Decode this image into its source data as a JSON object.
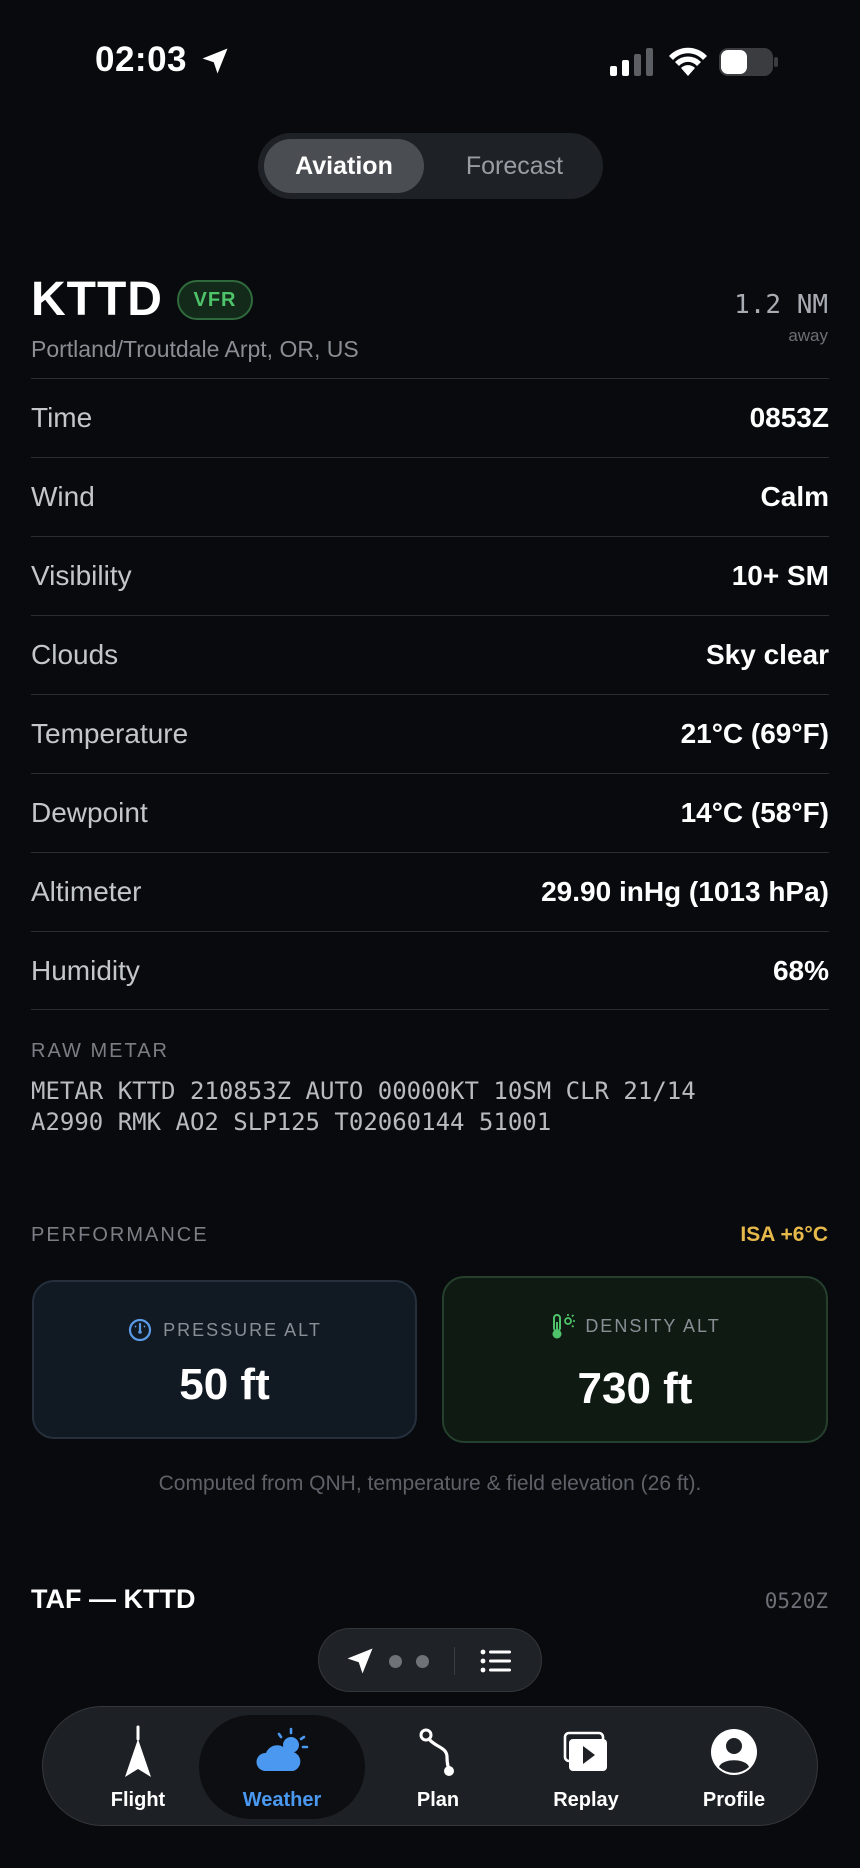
{
  "status_bar": {
    "time": "02:03"
  },
  "segment": {
    "options": [
      "Aviation",
      "Forecast"
    ],
    "selected": "Aviation"
  },
  "station": {
    "id": "KTTD",
    "category": "VFR",
    "name": "Portland/Troutdale Arpt, OR, US",
    "distance": "1.2 NM",
    "distance_suffix": "away"
  },
  "rows": [
    {
      "label": "Time",
      "value": "0853Z"
    },
    {
      "label": "Wind",
      "value": "Calm"
    },
    {
      "label": "Visibility",
      "value": "10+ SM"
    },
    {
      "label": "Clouds",
      "value": "Sky clear"
    },
    {
      "label": "Temperature",
      "value": "21°C (69°F)"
    },
    {
      "label": "Dewpoint",
      "value": "14°C (58°F)"
    },
    {
      "label": "Altimeter",
      "value": "29.90 inHg (1013 hPa)"
    },
    {
      "label": "Humidity",
      "value": "68%"
    }
  ],
  "raw_metar": {
    "label": "RAW METAR",
    "text": "METAR KTTD 210853Z AUTO 00000KT 10SM CLR 21/14\nA2990 RMK AO2 SLP125 T02060144 51001"
  },
  "performance": {
    "label": "PERFORMANCE",
    "isa": "ISA +6°C",
    "pressure_alt_label": "PRESSURE ALT",
    "pressure_alt_value": "50 ft",
    "density_alt_label": "DENSITY ALT",
    "density_alt_value": "730 ft",
    "note": "Computed from QNH, temperature & field elevation (26 ft)."
  },
  "taf": {
    "title": "TAF — KTTD",
    "time": "0520Z"
  },
  "tabs": [
    {
      "label": "Flight",
      "icon": "flight-icon"
    },
    {
      "label": "Weather",
      "icon": "weather-icon"
    },
    {
      "label": "Plan",
      "icon": "plan-icon"
    },
    {
      "label": "Replay",
      "icon": "replay-icon"
    },
    {
      "label": "Profile",
      "icon": "profile-icon"
    }
  ],
  "active_tab": "Weather",
  "colors": {
    "background": "#080a0d",
    "vfr_green": "#4fc36a",
    "isa_yellow": "#e6b94a",
    "accent_blue": "#4a98f0"
  }
}
